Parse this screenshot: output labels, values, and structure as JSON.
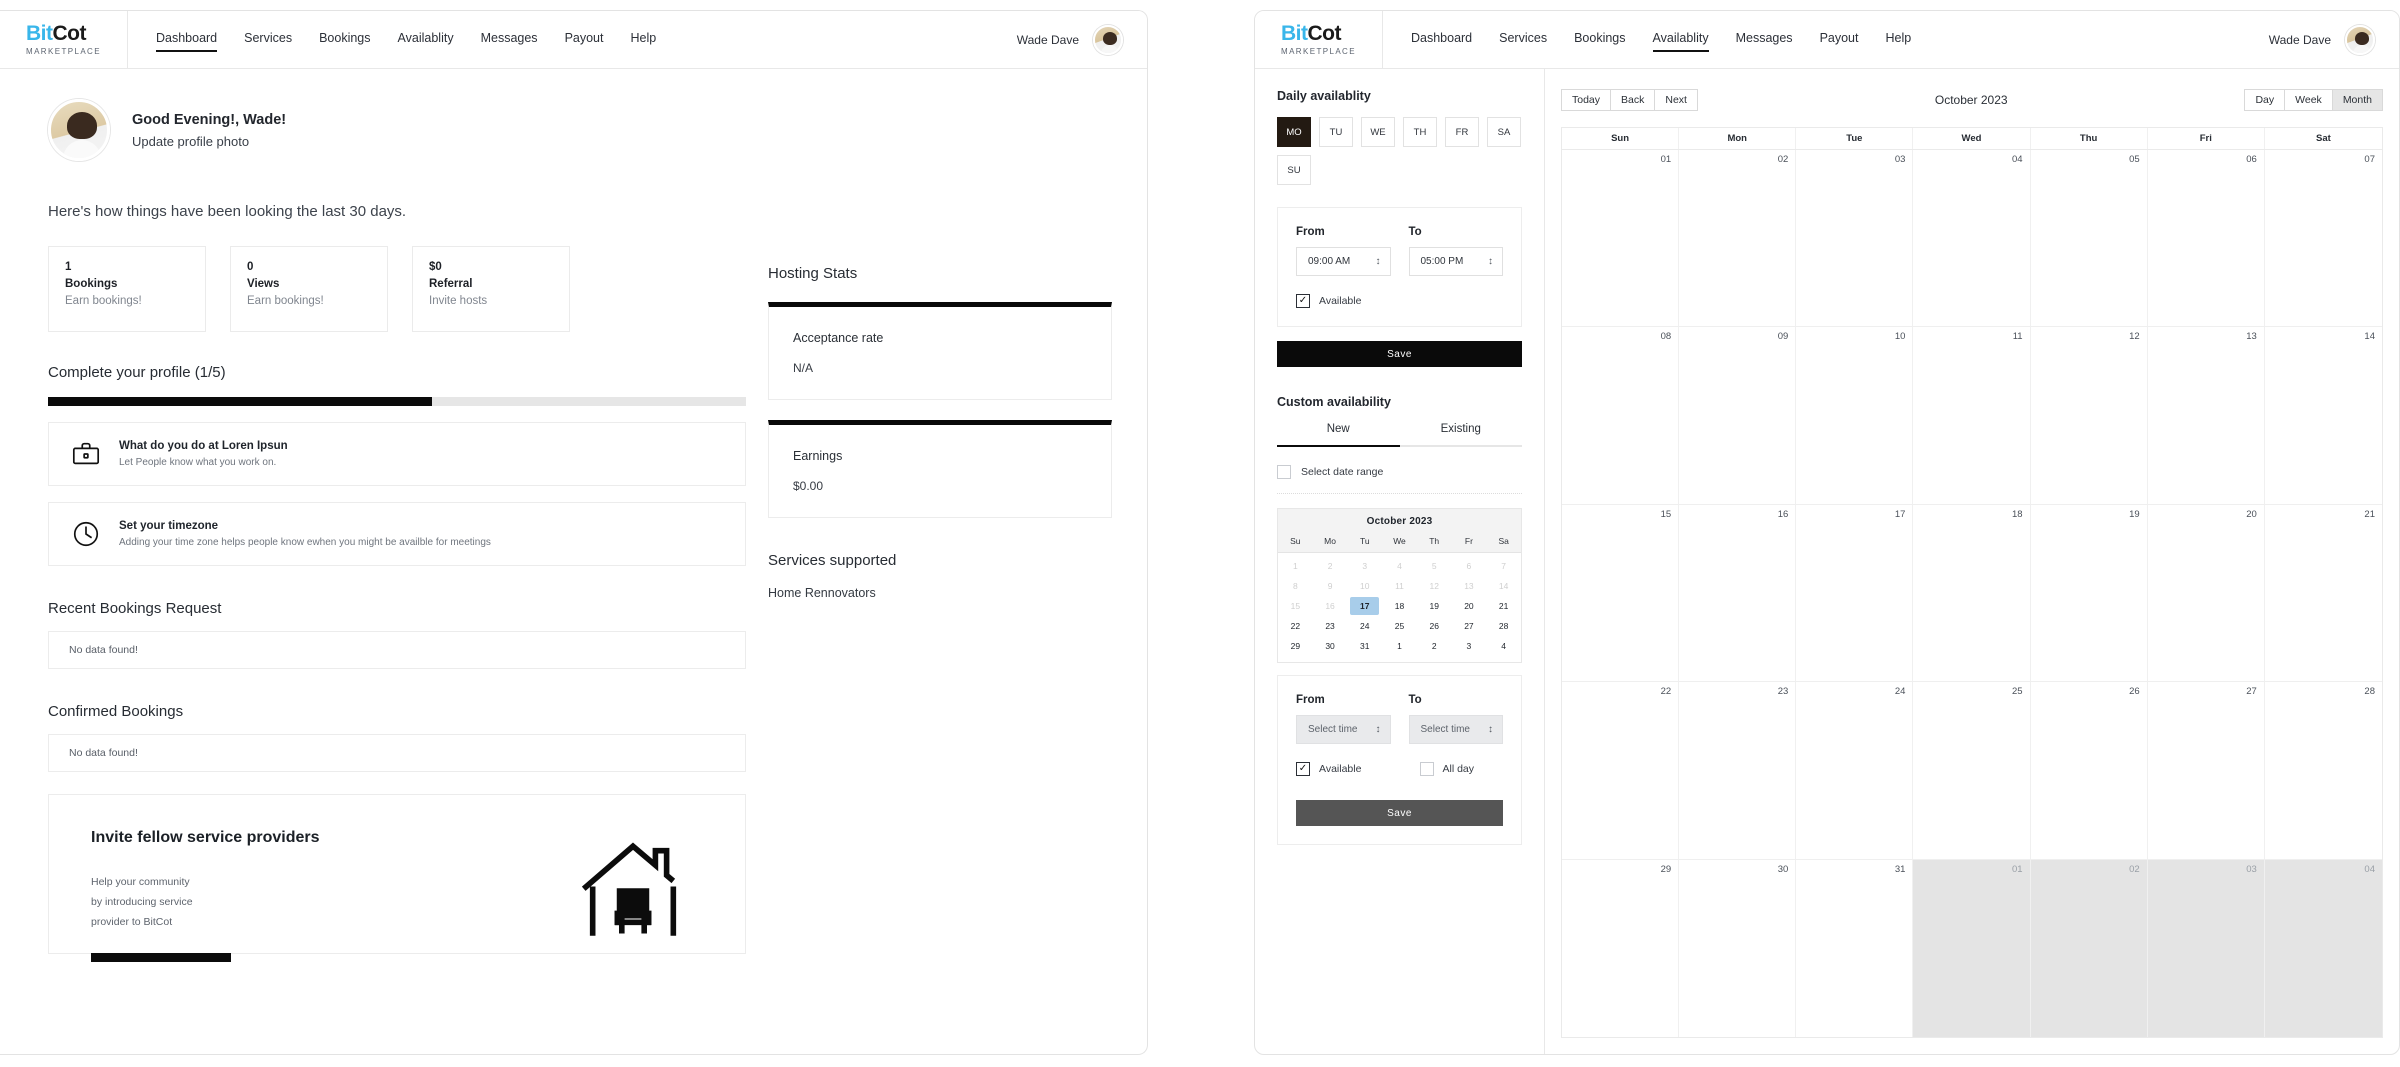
{
  "nav": {
    "brand": {
      "bit": "Bit",
      "cot": "Cot",
      "sub": "MARKETPLACE"
    },
    "links": [
      "Dashboard",
      "Services",
      "Bookings",
      "Availablity",
      "Messages",
      "Payout",
      "Help"
    ],
    "user": "Wade Dave"
  },
  "dashboard": {
    "greeting": "Good Evening!, Wade!",
    "update_photo": "Update profile photo",
    "lead": "Here's how things have been looking the last 30 days.",
    "stats": [
      {
        "value": "1",
        "label": "Bookings",
        "desc": "Earn bookings!"
      },
      {
        "value": "0",
        "label": "Views",
        "desc": "Earn bookings!"
      },
      {
        "value": "$0",
        "label": "Referral",
        "desc": "Invite hosts"
      }
    ],
    "profile_section_title": "Complete your profile (1/5)",
    "progress_percent": 55,
    "tasks": [
      {
        "title": "What do you do at Loren Ipsun",
        "desc": "Let People know what you work on.",
        "icon": "briefcase-icon"
      },
      {
        "title": "Set your timezone",
        "desc": "Adding your time zone helps people know ewhen you might be availble for meetings",
        "icon": "clock-icon"
      }
    ],
    "recent_title": "Recent Bookings Request",
    "recent_empty": "No data found!",
    "confirmed_title": "Confirmed Bookings",
    "confirmed_empty": "No data found!",
    "invite": {
      "title": "Invite fellow service providers",
      "line1": "Help your community",
      "line2": "by introducing service",
      "line3": "provider to BitCot"
    },
    "hosting": {
      "title": "Hosting Stats",
      "acceptance_label": "Acceptance rate",
      "acceptance_value": "N/A",
      "earnings_label": "Earnings",
      "earnings_value": "$0.00",
      "services_title": "Services supported",
      "services_item": "Home Rennovators"
    }
  },
  "availability": {
    "daily_title": "Daily availablity",
    "days": [
      "MO",
      "TU",
      "WE",
      "TH",
      "FR",
      "SA",
      "SU"
    ],
    "selected_day": "MO",
    "from_label": "From",
    "to_label": "To",
    "from_value": "09:00 AM",
    "to_value": "05:00 PM",
    "available_label": "Available",
    "save_label": "Save",
    "custom_title": "Custom availability",
    "tabs": [
      "New",
      "Existing"
    ],
    "active_tab": "New",
    "select_range_label": "Select date range",
    "custom_from_placeholder": "Select time",
    "custom_to_placeholder": "Select time",
    "all_day_label": "All day",
    "custom_save_label": "Save",
    "mini_calendar": {
      "title": "October 2023",
      "dow": [
        "Su",
        "Mo",
        "Tu",
        "We",
        "Th",
        "Fr",
        "Sa"
      ],
      "selected": 17,
      "weeks": [
        [
          {
            "d": "1",
            "dim": true
          },
          {
            "d": "2",
            "dim": true
          },
          {
            "d": "3",
            "dim": true
          },
          {
            "d": "4",
            "dim": true
          },
          {
            "d": "5",
            "dim": true
          },
          {
            "d": "6",
            "dim": true
          },
          {
            "d": "7",
            "dim": true
          }
        ],
        [
          {
            "d": "8",
            "dim": true
          },
          {
            "d": "9",
            "dim": true
          },
          {
            "d": "10",
            "dim": true
          },
          {
            "d": "11",
            "dim": true
          },
          {
            "d": "12",
            "dim": true
          },
          {
            "d": "13",
            "dim": true
          },
          {
            "d": "14",
            "dim": true
          }
        ],
        [
          {
            "d": "15",
            "dim": true
          },
          {
            "d": "16",
            "dim": true
          },
          {
            "d": "17",
            "sel": true
          },
          {
            "d": "18"
          },
          {
            "d": "19"
          },
          {
            "d": "20"
          },
          {
            "d": "21"
          }
        ],
        [
          {
            "d": "22"
          },
          {
            "d": "23"
          },
          {
            "d": "24"
          },
          {
            "d": "25"
          },
          {
            "d": "26"
          },
          {
            "d": "27"
          },
          {
            "d": "28"
          }
        ],
        [
          {
            "d": "29"
          },
          {
            "d": "30"
          },
          {
            "d": "31"
          },
          {
            "d": "1"
          },
          {
            "d": "2"
          },
          {
            "d": "3"
          },
          {
            "d": "4"
          }
        ]
      ]
    }
  },
  "calendar": {
    "nav_buttons": [
      "Today",
      "Back",
      "Next"
    ],
    "title": "October 2023",
    "views": [
      "Day",
      "Week",
      "Month"
    ],
    "active_view": "Month",
    "dow": [
      "Sun",
      "Mon",
      "Tue",
      "Wed",
      "Thu",
      "Fri",
      "Sat"
    ],
    "weeks": [
      [
        {
          "d": "01"
        },
        {
          "d": "02"
        },
        {
          "d": "03"
        },
        {
          "d": "04"
        },
        {
          "d": "05"
        },
        {
          "d": "06"
        },
        {
          "d": "07"
        }
      ],
      [
        {
          "d": "08"
        },
        {
          "d": "09"
        },
        {
          "d": "10"
        },
        {
          "d": "11"
        },
        {
          "d": "12"
        },
        {
          "d": "13"
        },
        {
          "d": "14"
        }
      ],
      [
        {
          "d": "15"
        },
        {
          "d": "16"
        },
        {
          "d": "17"
        },
        {
          "d": "18"
        },
        {
          "d": "19"
        },
        {
          "d": "20"
        },
        {
          "d": "21"
        }
      ],
      [
        {
          "d": "22"
        },
        {
          "d": "23"
        },
        {
          "d": "24"
        },
        {
          "d": "25"
        },
        {
          "d": "26"
        },
        {
          "d": "27"
        },
        {
          "d": "28"
        }
      ],
      [
        {
          "d": "29"
        },
        {
          "d": "30"
        },
        {
          "d": "31"
        },
        {
          "d": "01",
          "off": true
        },
        {
          "d": "02",
          "off": true
        },
        {
          "d": "03",
          "off": true
        },
        {
          "d": "04",
          "off": true
        }
      ]
    ]
  },
  "colors": {
    "brand_blue": "#39b6ea",
    "accent_dark": "#0a0a0a",
    "selected_day": "#a8cdea"
  }
}
